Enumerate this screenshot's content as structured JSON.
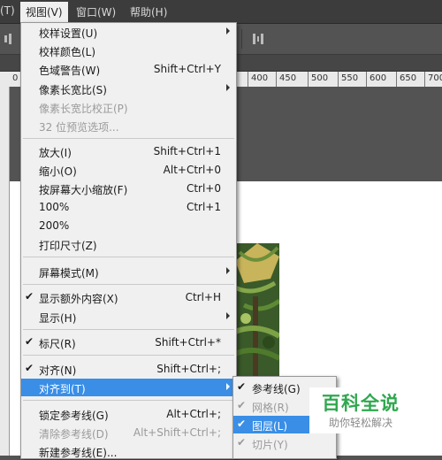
{
  "menubar": {
    "items": [
      {
        "label": "(T)"
      },
      {
        "label": "视图(V)"
      },
      {
        "label": "窗口(W)"
      },
      {
        "label": "帮助(H)"
      }
    ]
  },
  "ruler": {
    "labels": [
      "0",
      "400",
      "450",
      "500",
      "550",
      "600",
      "650",
      "700"
    ]
  },
  "view_menu": {
    "items": [
      {
        "label": "校样设置(U)",
        "shortcut": "",
        "submenu": true
      },
      {
        "label": "校样颜色(L)",
        "shortcut": ""
      },
      {
        "label": "色域警告(W)",
        "shortcut": "Shift+Ctrl+Y"
      },
      {
        "label": "像素长宽比(S)",
        "shortcut": "",
        "submenu": true
      },
      {
        "label": "像素长宽比校正(P)",
        "shortcut": "",
        "disabled": true
      },
      {
        "label": "32 位预览选项...",
        "shortcut": "",
        "disabled": true
      },
      {
        "label": "放大(I)",
        "shortcut": "Shift+Ctrl+1"
      },
      {
        "label": "缩小(O)",
        "shortcut": "Alt+Ctrl+0"
      },
      {
        "label": "按屏幕大小缩放(F)",
        "shortcut": "Ctrl+0"
      },
      {
        "label": "100%",
        "shortcut": "Ctrl+1"
      },
      {
        "label": "200%",
        "shortcut": ""
      },
      {
        "label": "打印尺寸(Z)",
        "shortcut": ""
      },
      {
        "label": "屏幕模式(M)",
        "shortcut": "",
        "submenu": true
      },
      {
        "label": "显示额外内容(X)",
        "shortcut": "Ctrl+H",
        "checked": true
      },
      {
        "label": "显示(H)",
        "shortcut": "",
        "submenu": true
      },
      {
        "label": "标尺(R)",
        "shortcut": "Shift+Ctrl+*",
        "checked": true
      },
      {
        "label": "对齐(N)",
        "shortcut": "Shift+Ctrl+;",
        "checked": true
      },
      {
        "label": "对齐到(T)",
        "shortcut": "",
        "submenu": true,
        "highlighted": true
      },
      {
        "label": "锁定参考线(G)",
        "shortcut": "Alt+Ctrl+;"
      },
      {
        "label": "清除参考线(D)",
        "shortcut": "Alt+Shift+Ctrl+;",
        "disabled": true
      },
      {
        "label": "新建参考线(E)...",
        "shortcut": ""
      }
    ]
  },
  "snap_to_submenu": {
    "items": [
      {
        "label": "参考线(G)",
        "checked": true
      },
      {
        "label": "网格(R)",
        "checked": true,
        "disabled": true
      },
      {
        "label": "图层(L)",
        "checked": true,
        "highlighted": true
      },
      {
        "label": "切片(Y)",
        "checked": true,
        "disabled": true
      }
    ]
  },
  "watermark": {
    "title": "百科全说",
    "subtitle": "助你轻松解决"
  },
  "colors": {
    "menu_bg": "#f0f0f0",
    "highlight": "#3a8ee6",
    "app_bg": "#535353",
    "watermark_green": "#2fa84f"
  }
}
